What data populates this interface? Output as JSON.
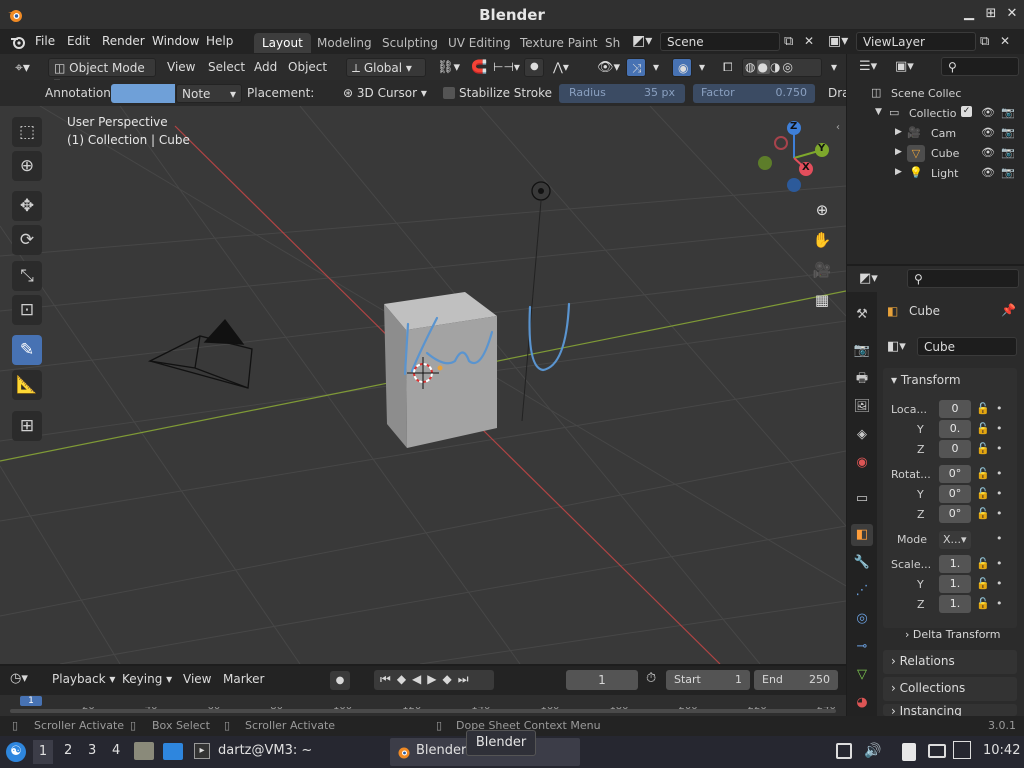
{
  "window": {
    "title": "Blender"
  },
  "menus": [
    "File",
    "Edit",
    "Render",
    "Window",
    "Help"
  ],
  "workspaces": [
    "Layout",
    "Modeling",
    "Sculpting",
    "UV Editing",
    "Texture Paint",
    "Sh"
  ],
  "scene": {
    "name": "Scene",
    "view_layer": "ViewLayer"
  },
  "header": {
    "mode": "Object Mode",
    "menus": [
      "View",
      "Select",
      "Add",
      "Object"
    ],
    "orientation": "Global"
  },
  "toolsettings": {
    "annotation_label": "Annotation:",
    "annotation_color": "#6fa0d8",
    "layer": "Note",
    "placement_label": "Placement:",
    "placement": "3D Cursor",
    "stabilize": "Stabilize Stroke",
    "radius_label": "Radius",
    "radius": "35 px",
    "factor_label": "Factor",
    "factor": "0.750",
    "extra": "Dra"
  },
  "viewport": {
    "perspective": "User Perspective",
    "context": "(1) Collection | Cube",
    "gizmo": {
      "x": "X",
      "y": "Y",
      "z": "Z"
    }
  },
  "outliner": {
    "root": "Scene Collec",
    "collection": "Collectio",
    "items": [
      "Cam",
      "Cube",
      "Light"
    ]
  },
  "properties": {
    "object": "Cube",
    "data_name": "Cube",
    "transform": "Transform",
    "location": "Loca...",
    "rotation": "Rotat...",
    "scale": "Scale...",
    "mode_label": "Mode",
    "mode_value": "X...",
    "axes": [
      "Y",
      "Z"
    ],
    "loc": [
      "0",
      "0.",
      "0"
    ],
    "rot": [
      "0°",
      "0°",
      "0°"
    ],
    "scl": [
      "1.",
      "1.",
      "1."
    ],
    "delta": "Delta Transform",
    "relations": "Relations",
    "collections": "Collections",
    "instancing": "Instancing"
  },
  "timeline": {
    "menus": [
      "Playback",
      "Keying",
      "View",
      "Marker"
    ],
    "frame": "1",
    "start_label": "Start",
    "start": "1",
    "end_label": "End",
    "end": "250",
    "ruler": [
      "20",
      "40",
      "60",
      "80",
      "100",
      "120",
      "140",
      "160",
      "180",
      "200",
      "220",
      "240"
    ],
    "current": "1"
  },
  "status": {
    "left": "Scroller Activate",
    "mid": "Box Select",
    "right": "Scroller Activate",
    "ctx": "Dope Sheet Context Menu",
    "version": "3.0.1"
  },
  "taskbar": {
    "desktops": [
      "1",
      "2",
      "3",
      "4"
    ],
    "terminal": "dartz@VM3: ~",
    "blender": "Blender",
    "tooltip": "Blender",
    "clock": "10:42"
  }
}
